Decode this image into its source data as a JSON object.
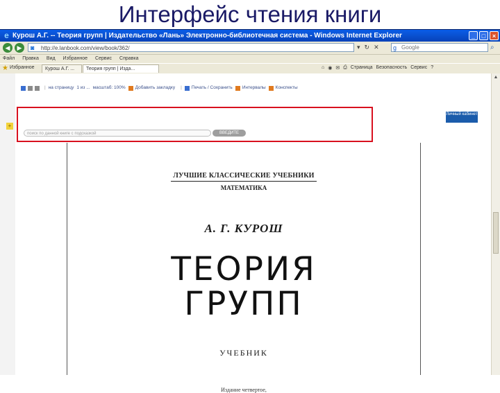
{
  "slide_title": "Интерфейс чтения книги",
  "window": {
    "title": "Курош А.Г. -- Теория групп | Издательство «Лань» Электронно-библиотечная система - Windows Internet Explorer",
    "controls": [
      "_",
      "□",
      "×"
    ]
  },
  "address_bar": {
    "back": "◀",
    "forward": "▶",
    "url": "http://e.lanbook.com/view/book/362/",
    "search_placeholder": "Google"
  },
  "menu": [
    "Файл",
    "Правка",
    "Вид",
    "Избранное",
    "Сервис",
    "Справка"
  ],
  "favorites": {
    "label": "Избранное",
    "tabs": [
      {
        "label": "Курош А.Г. ..."
      },
      {
        "label": "Теория групп | Изда..."
      }
    ],
    "commands": [
      "Страница",
      "Безопасность",
      "Сервис"
    ]
  },
  "app_toolbar": {
    "page_nav": "на страницу",
    "page_info": "1  из ...",
    "scale": "масштаб: 100%",
    "add_bookmark": "Добавить закладку",
    "print_save": "Печать / Сохранить",
    "intervals": "Интервалы",
    "contents": "Конспекты",
    "search_placeholder": "поиск по данной книге с подсказкой",
    "search_button": "ВВЕДИТЕ",
    "cabinet_button": "Личный кабинет"
  },
  "book": {
    "series_line1": "ЛУЧШИЕ КЛАССИЧЕСКИЕ УЧЕБНИКИ",
    "series_line2": "МАТЕМАТИКА",
    "author": "А. Г. КУРОШ",
    "title_line1": "ТЕОРИЯ",
    "title_line2": "ГРУПП",
    "type": "УЧЕБНИК",
    "edition": "Издание четвертое,"
  }
}
